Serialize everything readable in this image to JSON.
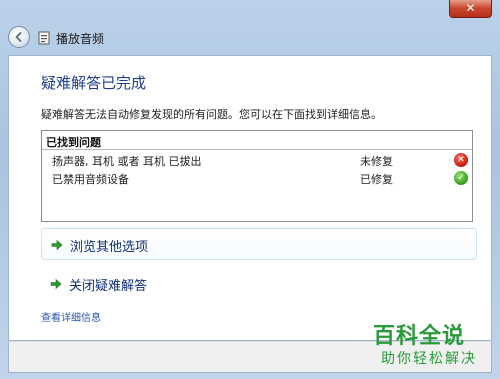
{
  "window": {
    "title": "播放音频",
    "close_symbol": "✕"
  },
  "main": {
    "heading": "疑难解答已完成",
    "description": "疑难解答无法自动修复发现的所有问题。您可以在下面找到详细信息。",
    "problems_header": "已找到问题",
    "problems": [
      {
        "name": "扬声器, 耳机 或者 耳机 已拔出",
        "status": "未修复",
        "icon": "error-icon"
      },
      {
        "name": "已禁用音频设备",
        "status": "已修复",
        "icon": "check-icon"
      }
    ],
    "options": [
      {
        "label": "浏览其他选项",
        "icon": "green-arrow-icon"
      },
      {
        "label": "关闭疑难解答",
        "icon": "green-arrow-icon"
      }
    ],
    "details_link": "查看详细信息"
  },
  "watermark": {
    "main": "百科全说",
    "sub": "助你轻松解决"
  },
  "colors": {
    "heading": "#1e3d8f",
    "link": "#2656b8",
    "watermark": "#2a9b3a",
    "error": "#d21f14",
    "ok": "#3ea624"
  }
}
